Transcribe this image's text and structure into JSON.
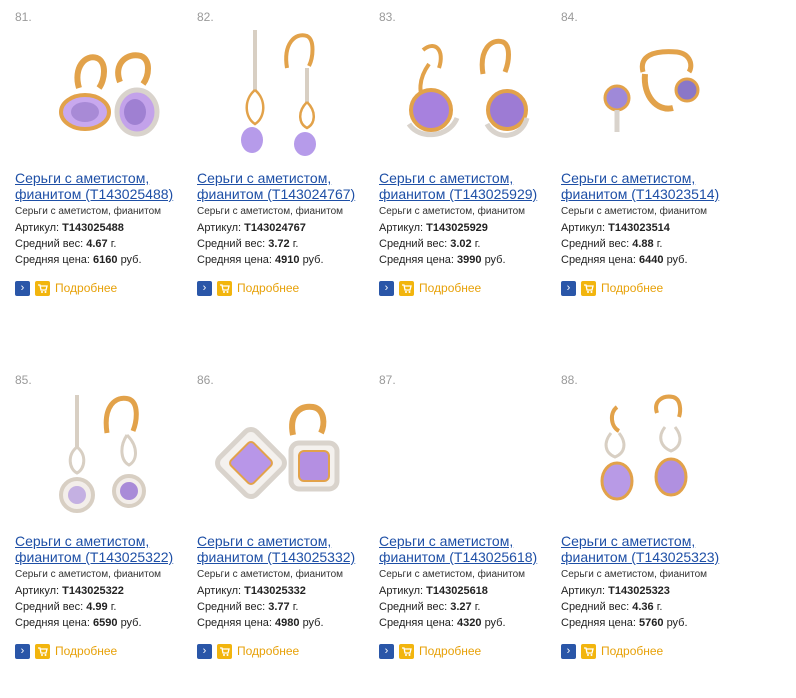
{
  "labels": {
    "article": "Артикул:",
    "weight": "Средний вес:",
    "weight_unit": "г.",
    "price": "Средняя цена:",
    "price_unit": "руб.",
    "more": "Подробнее"
  },
  "products": [
    {
      "num": "81.",
      "title1": "Серьги с аметистом,",
      "title2": "фианитом (Т143025488)",
      "desc": "Серьги с аметистом, фианитом",
      "article": "Т143025488",
      "weight": "4.67",
      "price": "6160"
    },
    {
      "num": "82.",
      "title1": "Серьги с аметистом,",
      "title2": "фианитом (Т143024767)",
      "desc": "Серьги с аметистом, фианитом",
      "article": "Т143024767",
      "weight": "3.72",
      "price": "4910"
    },
    {
      "num": "83.",
      "title1": "Серьги с аметистом,",
      "title2": "фианитом (Т143025929)",
      "desc": "Серьги с аметистом, фианитом",
      "article": "Т143025929",
      "weight": "3.02",
      "price": "3990"
    },
    {
      "num": "84.",
      "title1": "Серьги с аметистом,",
      "title2": "фианитом (Т143023514)",
      "desc": "Серьги с аметистом, фианитом",
      "article": "Т143023514",
      "weight": "4.88",
      "price": "6440"
    },
    {
      "num": "85.",
      "title1": "Серьги с аметистом,",
      "title2": "фианитом (Т143025322)",
      "desc": "Серьги с аметистом, фианитом",
      "article": "Т143025322",
      "weight": "4.99",
      "price": "6590"
    },
    {
      "num": "86.",
      "title1": "Серьги с аметистом,",
      "title2": "фианитом (Т143025332)",
      "desc": "Серьги с аметистом, фианитом",
      "article": "Т143025332",
      "weight": "3.77",
      "price": "4980"
    },
    {
      "num": "87.",
      "title1": "Серьги с аметистом,",
      "title2": "фианитом (Т143025618)",
      "desc": "Серьги с аметистом, фианитом",
      "article": "Т143025618",
      "weight": "3.27",
      "price": "4320"
    },
    {
      "num": "88.",
      "title1": "Серьги с аметистом,",
      "title2": "фианитом (Т143025323)",
      "desc": "Серьги с аметистом, фианитом",
      "article": "Т143025323",
      "weight": "4.36",
      "price": "5760"
    }
  ],
  "colors": {
    "link": "#1e4fa6",
    "more": "#e7a109",
    "go_button": "#2a56a8",
    "cart_button": "#f2b50e",
    "gold": "#e2a24a",
    "amethyst": "#b38be0"
  },
  "icons": {
    "go": "arrow-right-icon",
    "cart": "cart-icon"
  }
}
